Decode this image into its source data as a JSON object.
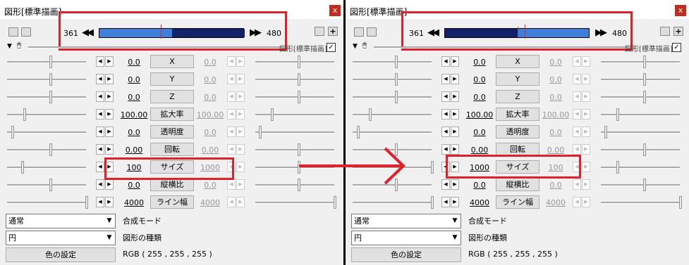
{
  "left": {
    "title": "図形[標準描画]",
    "close": "x",
    "frame_start": "361",
    "frame_end": "480",
    "nav_prev": "◀◀",
    "nav_next": "▶▶",
    "mini_label": "図形[標準描画]",
    "checkbox": "✓",
    "rows": [
      {
        "label": "X",
        "v1": "0.0",
        "v2": "0.0"
      },
      {
        "label": "Y",
        "v1": "0.0",
        "v2": "0.0"
      },
      {
        "label": "Z",
        "v1": "0.0",
        "v2": "0.0"
      },
      {
        "label": "拡大率",
        "v1": "100.00",
        "v2": "100.00"
      },
      {
        "label": "透明度",
        "v1": "0.0",
        "v2": "0.0"
      },
      {
        "label": "回転",
        "v1": "0.00",
        "v2": "0.00"
      },
      {
        "label": "サイズ",
        "v1": "100",
        "v2": "1000"
      },
      {
        "label": "縦横比",
        "v1": "0.0",
        "v2": "0.0"
      },
      {
        "label": "ライン幅",
        "v1": "4000",
        "v2": "4000"
      }
    ],
    "blend_mode": "通常",
    "blend_mode_label": "合成モード",
    "shape_type": "円",
    "shape_type_label": "図形の種類",
    "color_button": "色の設定",
    "rgb": "RGB ( 255 , 255 , 255 )"
  },
  "right": {
    "title": "図形[標準描画]",
    "close": "x",
    "frame_start": "361",
    "frame_end": "480",
    "nav_prev": "◀◀",
    "nav_next": "▶▶",
    "mini_label": "図形[標準描画]",
    "checkbox": "✓",
    "rows": [
      {
        "label": "X",
        "v1": "0.0",
        "v2": "0.0"
      },
      {
        "label": "Y",
        "v1": "0.0",
        "v2": "0.0"
      },
      {
        "label": "Z",
        "v1": "0.0",
        "v2": "0.0"
      },
      {
        "label": "拡大率",
        "v1": "100.00",
        "v2": "100.00"
      },
      {
        "label": "透明度",
        "v1": "0.0",
        "v2": "0.0"
      },
      {
        "label": "回転",
        "v1": "0.00",
        "v2": "0.00"
      },
      {
        "label": "サイズ",
        "v1": "1000",
        "v2": "100"
      },
      {
        "label": "縦横比",
        "v1": "0.0",
        "v2": "0.0"
      },
      {
        "label": "ライン幅",
        "v1": "4000",
        "v2": "4000"
      }
    ],
    "blend_mode": "通常",
    "blend_mode_label": "合成モード",
    "shape_type": "円",
    "shape_type_label": "図形の種類",
    "color_button": "色の設定",
    "rgb": "RGB ( 255 , 255 , 255 )"
  },
  "colors": {
    "annotation_red": "#e0202a",
    "timeline_light": "#3d7fdb",
    "timeline_dark": "#11226b"
  }
}
